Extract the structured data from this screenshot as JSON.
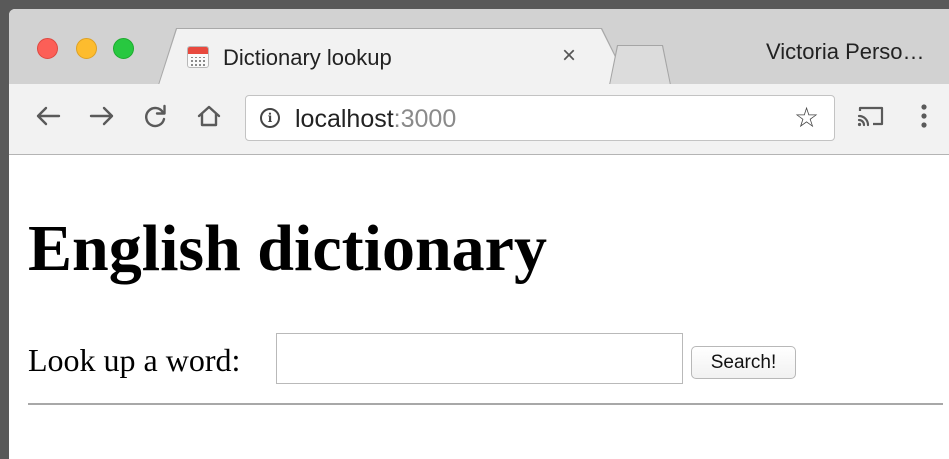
{
  "browser": {
    "tab": {
      "title": "Dictionary lookup",
      "close_glyph": "×",
      "favicon": "calendar-icon"
    },
    "profile_name": "Victoria Perso…",
    "toolbar": {
      "back_icon": "arrow-left-icon",
      "forward_icon": "arrow-right-icon",
      "reload_icon": "reload-icon",
      "home_icon": "home-icon",
      "cast_icon": "cast-icon",
      "menu_icon": "kebab-menu-icon"
    },
    "omnibox": {
      "host": "localhost",
      "port": ":3000",
      "star_glyph": "☆"
    }
  },
  "page": {
    "heading": "English dictionary",
    "lookup_label": "Look up a word:",
    "search_input_value": "",
    "search_button_label": "Search!"
  },
  "colors": {
    "traffic_red": "#fc5f57",
    "traffic_yellow": "#fdbc2e",
    "traffic_green": "#28c840",
    "port_text": "#8a8a8a"
  }
}
